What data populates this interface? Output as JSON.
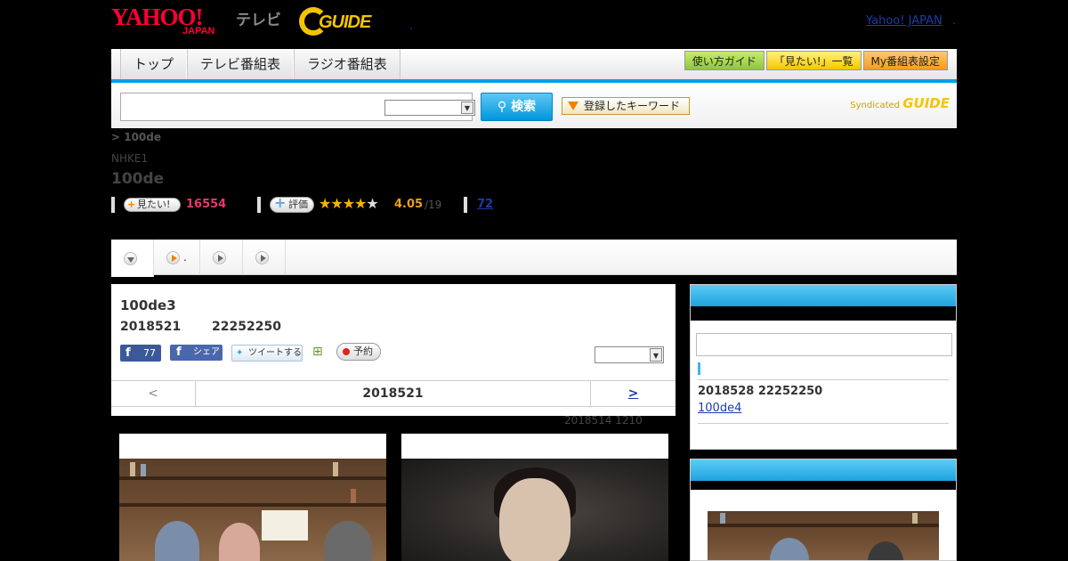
{
  "header": {
    "logo_yahoo": "YAHOO!",
    "logo_japan": "JAPAN",
    "logo_tv": "テレビ",
    "gguide": "GUIDE",
    "yahoo_japan_link": "Yahoo! JAPAN",
    "dot": "."
  },
  "nav": {
    "tabs": [
      "トップ",
      "テレビ番組表",
      "ラジオ番組表"
    ],
    "buttons": [
      "使い方ガイド",
      "「見たい!」一覧",
      "My番組表設定"
    ]
  },
  "search": {
    "button": "検索",
    "keyword_button": "登録したキーワード",
    "syndicated": "Syndicated",
    "syndicated_brand": "GUIDE"
  },
  "program": {
    "breadcrumb": "> 100de",
    "channel": "NHKE1",
    "title": "100de",
    "mitai_label": "見たい!",
    "mitai_count": "16554",
    "hyouka_label": "評価",
    "stars_on": "★★★★",
    "stars_off": "★",
    "rating": "4.05",
    "rating_total": "/19",
    "review_count": "72",
    "rating_value": 4.05,
    "rating_max": 5
  },
  "subtabs": [
    ".",
    "",
    "",
    ""
  ],
  "episode": {
    "title": "100de3",
    "date": "2018521",
    "time": "22252250",
    "fb_like_count": "77",
    "fb_share": "シェア",
    "tweet": "ツイートする",
    "reserve": "予約",
    "pager_prev": "<",
    "pager_current": "2018521",
    "pager_next": ">",
    "updated": "2018514  1210"
  },
  "sidebar": {
    "next_date": "2018528  22252250",
    "next_link": "100de4"
  },
  "colors": {
    "accent_blue": "#00a0e9",
    "yahoo_red": "#ff0033",
    "gguide_yellow": "#f5c400",
    "mitai_pink": "#e23a6c"
  }
}
